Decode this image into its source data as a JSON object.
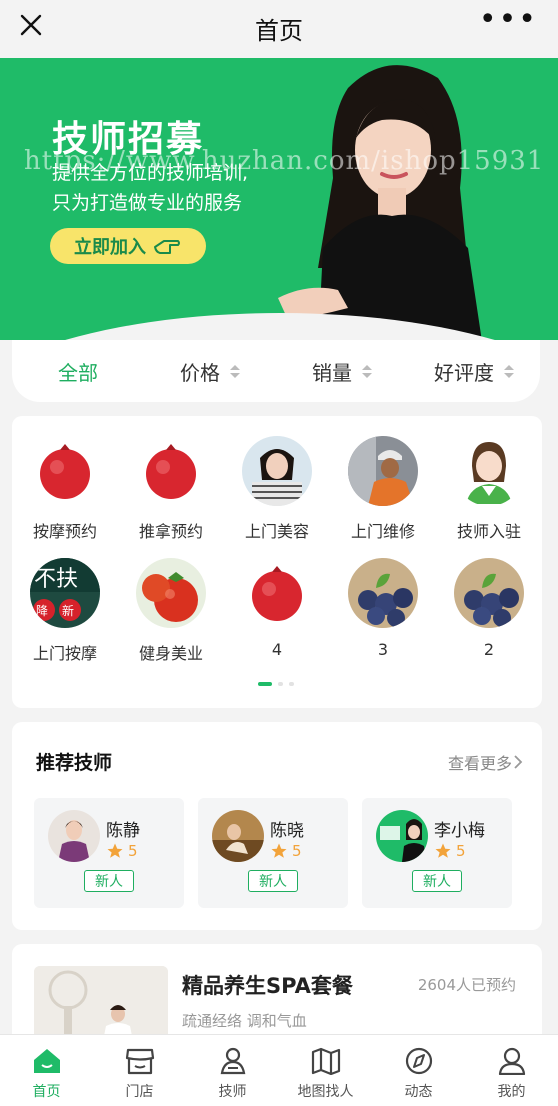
{
  "header": {
    "title": "首页",
    "more": "•••"
  },
  "banner": {
    "title": "技师招募",
    "subtitle_line1": "提供全方位的技师培训,",
    "subtitle_line2": "只为打造做专业的服务",
    "cta": "立即加入",
    "watermark": "https://www.huzhan.com/ishop15931"
  },
  "filters": [
    {
      "label": "全部",
      "active": true
    },
    {
      "label": "价格"
    },
    {
      "label": "销量"
    },
    {
      "label": "好评度"
    }
  ],
  "categories": [
    {
      "label": "按摩预约",
      "icon": "pomegranate-icon"
    },
    {
      "label": "推拿预约",
      "icon": "pomegranate-icon"
    },
    {
      "label": "上门美容",
      "icon": "woman-photo-icon"
    },
    {
      "label": "上门维修",
      "icon": "repairman-photo-icon"
    },
    {
      "label": "技师入驻",
      "icon": "woman-cartoon-icon"
    },
    {
      "label": "上门按摩",
      "icon": "promo-sign-icon"
    },
    {
      "label": "健身美业",
      "icon": "tomato-icon"
    },
    {
      "label": "4",
      "icon": "pomegranate-icon"
    },
    {
      "label": "3",
      "icon": "blueberry-icon"
    },
    {
      "label": "2",
      "icon": "blueberry-icon"
    }
  ],
  "pager": {
    "pages": 3,
    "current": 1
  },
  "recommend": {
    "title": "推荐技师",
    "more": "查看更多",
    "techs": [
      {
        "name": "陈静",
        "rating": "5",
        "tag": "新人"
      },
      {
        "name": "陈晓",
        "rating": "5",
        "tag": "新人"
      },
      {
        "name": "李小梅",
        "rating": "5",
        "tag": "新人"
      }
    ]
  },
  "product": {
    "name": "精品养生SPA套餐",
    "booked": "2604人已预约",
    "desc": "疏通经络 调和气血"
  },
  "tabs": [
    {
      "label": "首页",
      "icon": "home-icon",
      "active": true
    },
    {
      "label": "门店",
      "icon": "store-icon"
    },
    {
      "label": "技师",
      "icon": "technician-icon"
    },
    {
      "label": "地图找人",
      "icon": "map-icon"
    },
    {
      "label": "动态",
      "icon": "compass-icon"
    },
    {
      "label": "我的",
      "icon": "user-icon"
    }
  ],
  "colors": {
    "brand": "#1fbb68",
    "accent_text": "#1fae60",
    "star": "#f2a33a",
    "cta_bg": "#f8e46a"
  }
}
